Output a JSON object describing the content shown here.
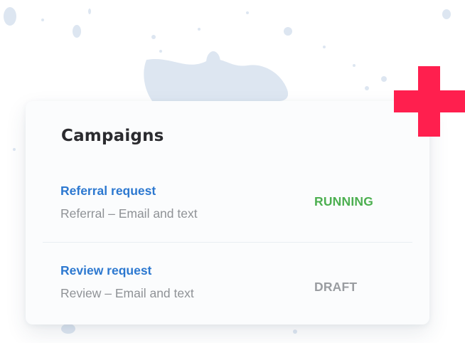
{
  "card": {
    "title": "Campaigns"
  },
  "campaigns": [
    {
      "name": "Referral request",
      "description": "Referral – Email and text",
      "status": "RUNNING",
      "status_color": "#4caf50"
    },
    {
      "name": "Review request",
      "description": "Review – Email and text",
      "status": "DRAFT",
      "status_color": "#9a9da1"
    }
  ],
  "colors": {
    "link": "#2c78d0",
    "plus_accent": "#ff1f4e",
    "splatter": "#dde6f1"
  },
  "decor": {
    "icon": "plus-icon"
  }
}
